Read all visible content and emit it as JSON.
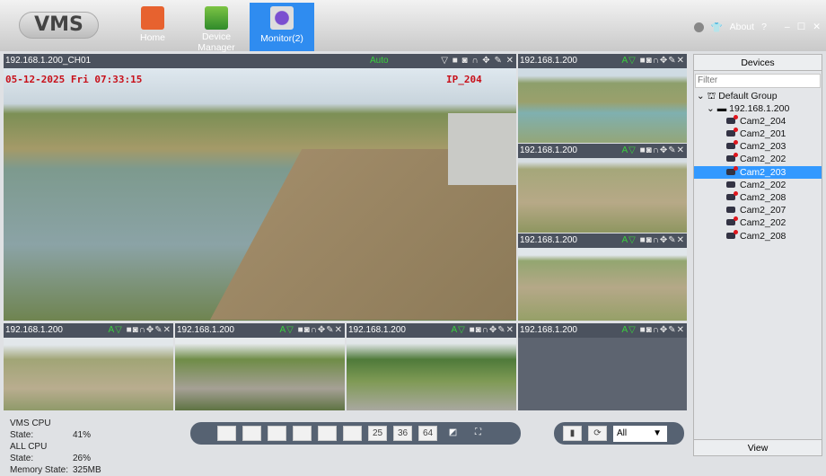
{
  "app": {
    "logo": "VMS"
  },
  "nav": [
    {
      "label": "Home"
    },
    {
      "label": "Device\nManager"
    },
    {
      "label": "Monitor(2)"
    }
  ],
  "topright": {
    "about": "About",
    "help": "?",
    "minimize": "–",
    "maximize": "☐",
    "close": "✕"
  },
  "main_tile": {
    "title": "192.168.1.200_CH01",
    "stream": "Auto",
    "osd_time": "05-12-2025 Fri 07:33:15",
    "osd_name": "IP_204"
  },
  "tiles": [
    {
      "title": "192.168.1.200"
    },
    {
      "title": "192.168.1.200"
    },
    {
      "title": "192.168.1.200"
    },
    {
      "title": "192.168.1.200"
    },
    {
      "title": "192.168.1.200"
    },
    {
      "title": "192.168.1.200"
    },
    {
      "title": "192.168.1.200"
    }
  ],
  "tile_tools": {
    "av": "A▽",
    "icons": [
      "record-icon",
      "snapshot-icon",
      "audio-icon",
      "ptz-icon",
      "color-adjust-icon",
      "close-icon"
    ]
  },
  "devices": {
    "header": "Devices",
    "filter_placeholder": "Filter",
    "group": "Default Group",
    "host": "192.168.1.200",
    "cameras": [
      {
        "name": "Cam2_204",
        "rec": true
      },
      {
        "name": "Cam2_201",
        "rec": true
      },
      {
        "name": "Cam2_203",
        "rec": true
      },
      {
        "name": "Cam2_202",
        "rec": true
      },
      {
        "name": "Cam2_203",
        "rec": true,
        "selected": true
      },
      {
        "name": "Cam2_202",
        "rec": false
      },
      {
        "name": "Cam2_208",
        "rec": true
      },
      {
        "name": "Cam2_207",
        "rec": false
      },
      {
        "name": "Cam2_202",
        "rec": true
      },
      {
        "name": "Cam2_208",
        "rec": true
      }
    ],
    "view": "View"
  },
  "stats": [
    {
      "label": "VMS CPU State:",
      "value": "41%"
    },
    {
      "label": "ALL CPU State:",
      "value": "26%"
    },
    {
      "label": "Memory State:",
      "value": "325MB"
    }
  ],
  "layouts": [
    "",
    "",
    "",
    "",
    "",
    "",
    "25",
    "36",
    "64"
  ],
  "stream_select": "All",
  "colors": {
    "accent": "#2f8cf0",
    "rec": "#e0161e",
    "auto": "#39d23c"
  }
}
